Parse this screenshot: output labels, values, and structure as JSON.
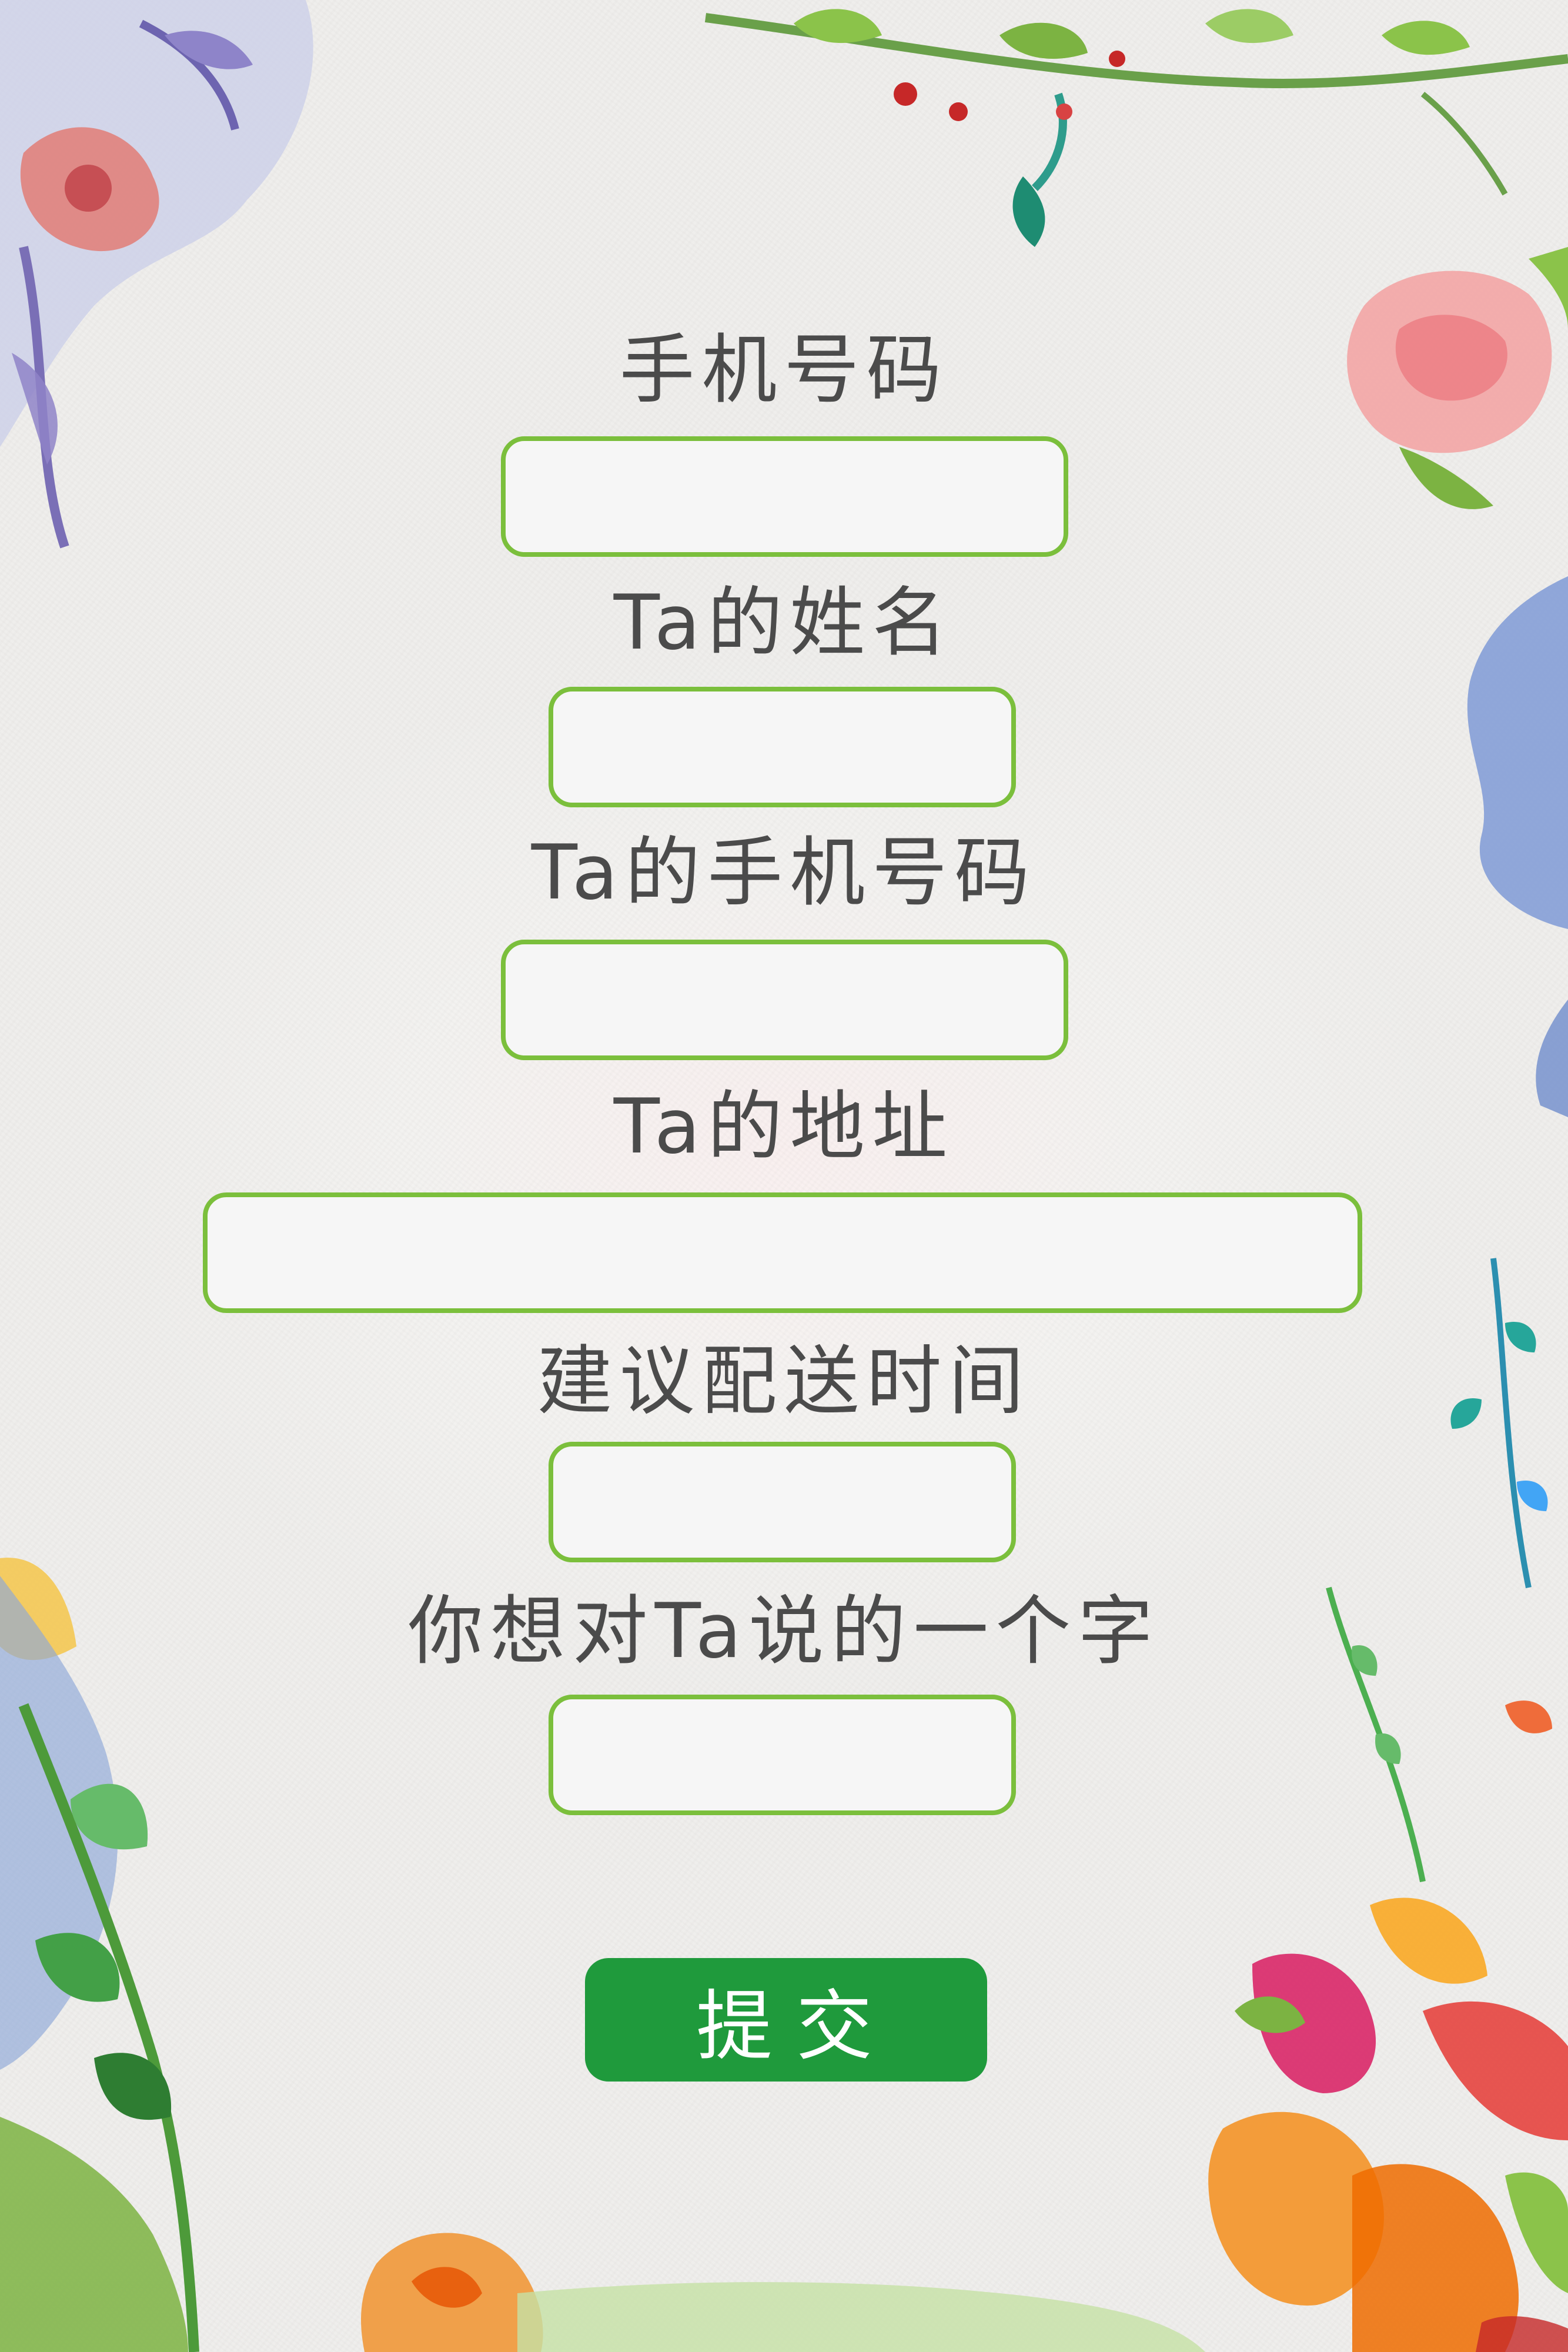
{
  "form": {
    "fields": [
      {
        "label": "手机号码",
        "value": ""
      },
      {
        "label": "Ta的姓名",
        "value": ""
      },
      {
        "label": "Ta的手机号码",
        "value": ""
      },
      {
        "label": "Ta的地址",
        "value": ""
      },
      {
        "label": "建议配送时间",
        "value": ""
      },
      {
        "label": "你想对Ta说的一个字",
        "value": ""
      }
    ],
    "submit_label": "提交"
  },
  "colors": {
    "input_border": "#7bbf3c",
    "input_fill": "#f6f6f6",
    "button": "#1f9a3c",
    "button_text": "#ffffff",
    "label_text": "#4b4b4b"
  },
  "decorations": {
    "icons": [
      "watercolor-flower-top-left-icon",
      "watercolor-vine-top-icon",
      "watercolor-rose-right-icon",
      "watercolor-blue-leaf-right-icon",
      "watercolor-floral-bottom-left-icon",
      "watercolor-floral-bottom-right-icon"
    ]
  }
}
